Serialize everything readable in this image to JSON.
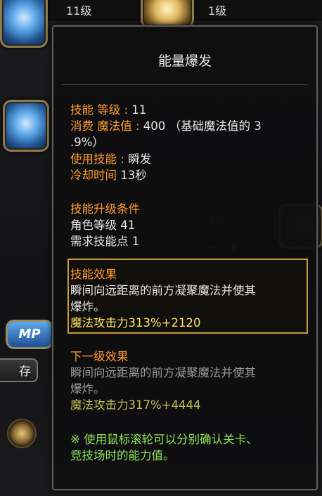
{
  "background": {
    "slot1_level": "11级",
    "slot2_level": "1级",
    "ghost_level": "1级",
    "mp_badge": "MP",
    "store_button": "存"
  },
  "tooltip": {
    "title": "能量爆发",
    "skill_level_label": "技能 等级 : ",
    "skill_level_value": "11",
    "cost_label": "消费 魔法值 : ",
    "cost_value": "400 （基础魔法值的 3",
    "cost_value_cont": ".9%）",
    "cast_label": "使用技能 : ",
    "cast_value": "瞬发",
    "cooldown_label": "冷却时间 ",
    "cooldown_value": "13秒",
    "upgrade_header": "技能升级条件",
    "upgrade_char_level": "角色等级 41",
    "upgrade_skill_points": "需求技能点 1",
    "effect_header": "技能效果",
    "effect_desc_1": "瞬间向远距离的前方凝聚魔法并使其",
    "effect_desc_2": "爆炸。",
    "effect_stat": "魔法攻击力313%+2120",
    "next_header": "下一级效果",
    "next_desc_1": "瞬间向远距离的前方凝聚魔法并使其",
    "next_desc_2": "爆炸。",
    "next_stat": "魔法攻击力317%+4444",
    "hint_1": "※ 使用鼠标滚轮可以分别确认关卡、",
    "hint_2": "竞技场时的能力值。"
  }
}
